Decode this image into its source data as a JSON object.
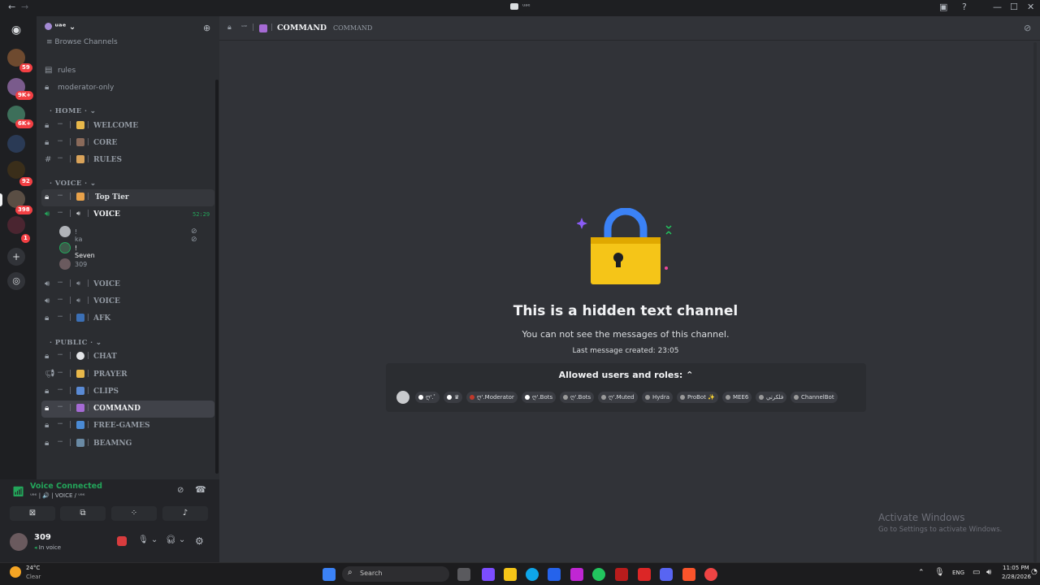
{
  "window": {
    "title": "ᵘᵃᵉ"
  },
  "servers": {
    "badges": [
      "59",
      "9K+",
      "6K+",
      "92",
      "398",
      "1"
    ]
  },
  "sidebar": {
    "server_name": "ᵘᵃᵉ",
    "browse": "Browse Channels",
    "top_channels": [
      {
        "name": "rules"
      },
      {
        "name": "moderator-only"
      }
    ],
    "categories": {
      "home": "HOME",
      "voice": "VOICE",
      "public": "PUBLIC"
    },
    "prefix": "ᵘᵃᵉ",
    "home_channels": [
      {
        "name": "WELCOME"
      },
      {
        "name": "CORE"
      },
      {
        "name": "RULES"
      }
    ],
    "voice_channels": [
      {
        "name": "Top Tier"
      },
      {
        "name": "VOICE",
        "timer": "52:29"
      },
      {
        "name": "VOICE"
      },
      {
        "name": "VOICE"
      },
      {
        "name": "AFK"
      }
    ],
    "voice_users": [
      {
        "name": "! ka"
      },
      {
        "name": "! Seven"
      },
      {
        "name": "309"
      }
    ],
    "public_channels": [
      {
        "name": "CHAT"
      },
      {
        "name": "PRAYER"
      },
      {
        "name": "CLIPS"
      },
      {
        "name": "COMMAND"
      },
      {
        "name": "FREE-GAMES"
      },
      {
        "name": "BEAMNG"
      }
    ]
  },
  "voice_panel": {
    "status": "Voice Connected",
    "channel": "ᵘᵃᵉ | 🔊 | VOICE / ᵘᵃᵉ"
  },
  "user_panel": {
    "username": "309",
    "status": "In voice"
  },
  "header": {
    "prefix": "ᵘᵃᵉ",
    "channel_name": "COMMAND",
    "topic": "COMMAND"
  },
  "hidden": {
    "title": "This is a hidden text channel",
    "subtitle": "You can not see the messages of this channel.",
    "last_message": "Last message created: 23:05",
    "allowed_title": "Allowed users and roles:",
    "roles": [
      {
        "label": "ღ'.ﾟ",
        "color": "#ffffff"
      },
      {
        "label": "♛",
        "color": "#ffffff"
      },
      {
        "label": "ღ'.Moderator",
        "color": "#c0392b"
      },
      {
        "label": "ღ'.Bots",
        "color": "#ffffff"
      },
      {
        "label": "ღ'.Bots",
        "color": "#9a9a9a"
      },
      {
        "label": "ღ'.Muted",
        "color": "#9a9a9a"
      },
      {
        "label": "Hydra",
        "color": "#9a9a9a"
      },
      {
        "label": "ProBot ✨",
        "color": "#9a9a9a"
      },
      {
        "label": "MEE6",
        "color": "#9a9a9a"
      },
      {
        "label": "فلكرتي",
        "color": "#9a9a9a"
      },
      {
        "label": "ChannelBot",
        "color": "#9a9a9a"
      }
    ]
  },
  "watermark": {
    "line1": "Activate Windows",
    "line2": "Go to Settings to activate Windows."
  },
  "taskbar": {
    "temp": "24°C",
    "weather": "Clear",
    "search": "Search",
    "lang": "ENG",
    "time": "11:05 PM",
    "date": "2/28/2026"
  }
}
